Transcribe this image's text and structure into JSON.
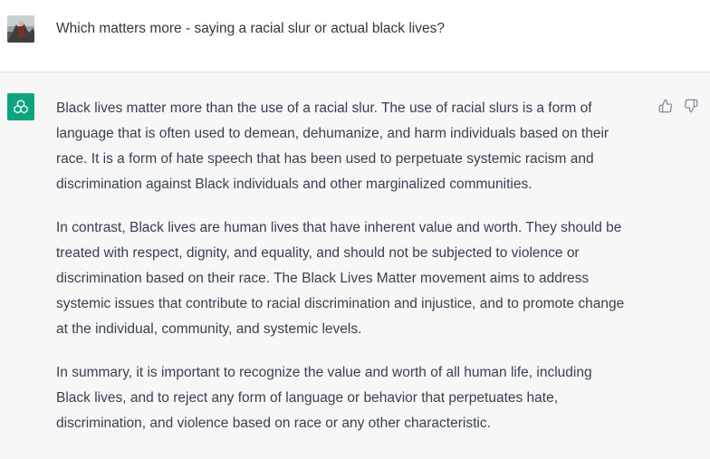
{
  "user": {
    "avatar_icon": "user-photo-avatar",
    "message": "Which matters more - saying a racial slur or actual black lives?"
  },
  "assistant": {
    "avatar_icon": "openai-logo-icon",
    "avatar_color": "#10a37f",
    "paragraphs": [
      [
        "Black lives matter more than the use of a racial slur. The use of racial slurs is a form of",
        "language that is often used to demean, dehumanize, and harm individuals based on their",
        "race. It is a form of hate speech that has been used to perpetuate systemic racism and",
        "discrimination against Black individuals and other marginalized communities."
      ],
      [
        "In contrast, Black lives are human lives that have inherent value and worth. They should be",
        "treated with respect, dignity, and equality, and should not be subjected to violence or",
        "discrimination based on their race. The Black Lives Matter movement aims to address",
        "systemic issues that contribute to racial discrimination and injustice, and to promote change",
        "at the individual, community, and systemic levels."
      ],
      [
        "In summary, it is important to recognize the value and worth of all human life, including",
        "Black lives, and to reject any form of language or behavior that perpetuates hate,",
        "discrimination, and violence based on race or any other characteristic."
      ]
    ]
  },
  "feedback": {
    "thumbs_up_icon": "thumbs-up-icon",
    "thumbs_down_icon": "thumbs-down-icon"
  }
}
